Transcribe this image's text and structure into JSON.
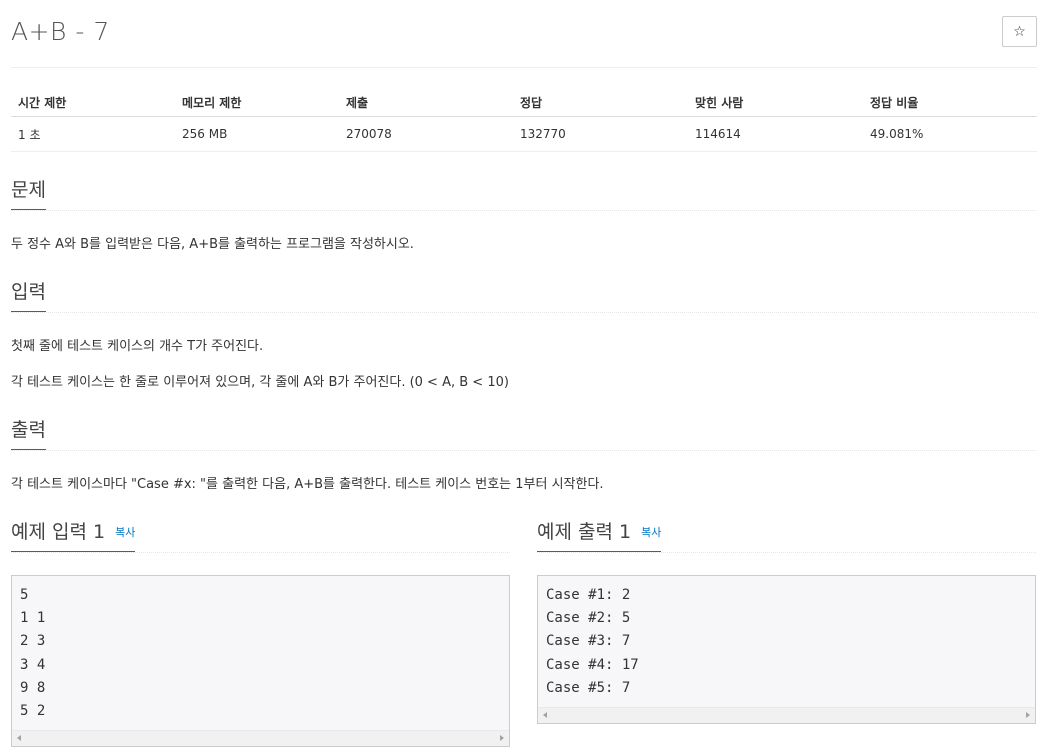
{
  "header": {
    "title": "A+B - 7",
    "star_icon": "☆"
  },
  "info_table": {
    "headers": [
      "시간 제한",
      "메모리 제한",
      "제출",
      "정답",
      "맞힌 사람",
      "정답 비율"
    ],
    "values": [
      "1 초",
      "256 MB",
      "270078",
      "132770",
      "114614",
      "49.081%"
    ]
  },
  "problem": {
    "heading": "문제",
    "text": "두 정수 A와 B를 입력받은 다음, A+B를 출력하는 프로그램을 작성하시오."
  },
  "input": {
    "heading": "입력",
    "line1": "첫째 줄에 테스트 케이스의 개수 T가 주어진다.",
    "line2": "각 테스트 케이스는 한 줄로 이루어져 있으며, 각 줄에 A와 B가 주어진다. (0 < A, B < 10)"
  },
  "output": {
    "heading": "출력",
    "text": "각 테스트 케이스마다 \"Case #x: \"를 출력한 다음, A+B를 출력한다. 테스트 케이스 번호는 1부터 시작한다."
  },
  "sample_input": {
    "heading": "예제 입력 1",
    "copy_label": "복사",
    "lines": [
      "5",
      "1 1",
      "2 3",
      "3 4",
      "9 8",
      "5 2"
    ]
  },
  "sample_output": {
    "heading": "예제 출력 1",
    "copy_label": "복사",
    "lines": [
      "Case #1: 2",
      "Case #2: 5",
      "Case #3: 7",
      "Case #4: 17",
      "Case #5: 7"
    ]
  },
  "colors": {
    "accent": "#0076c0",
    "code_bg": "#f7f7f9"
  }
}
